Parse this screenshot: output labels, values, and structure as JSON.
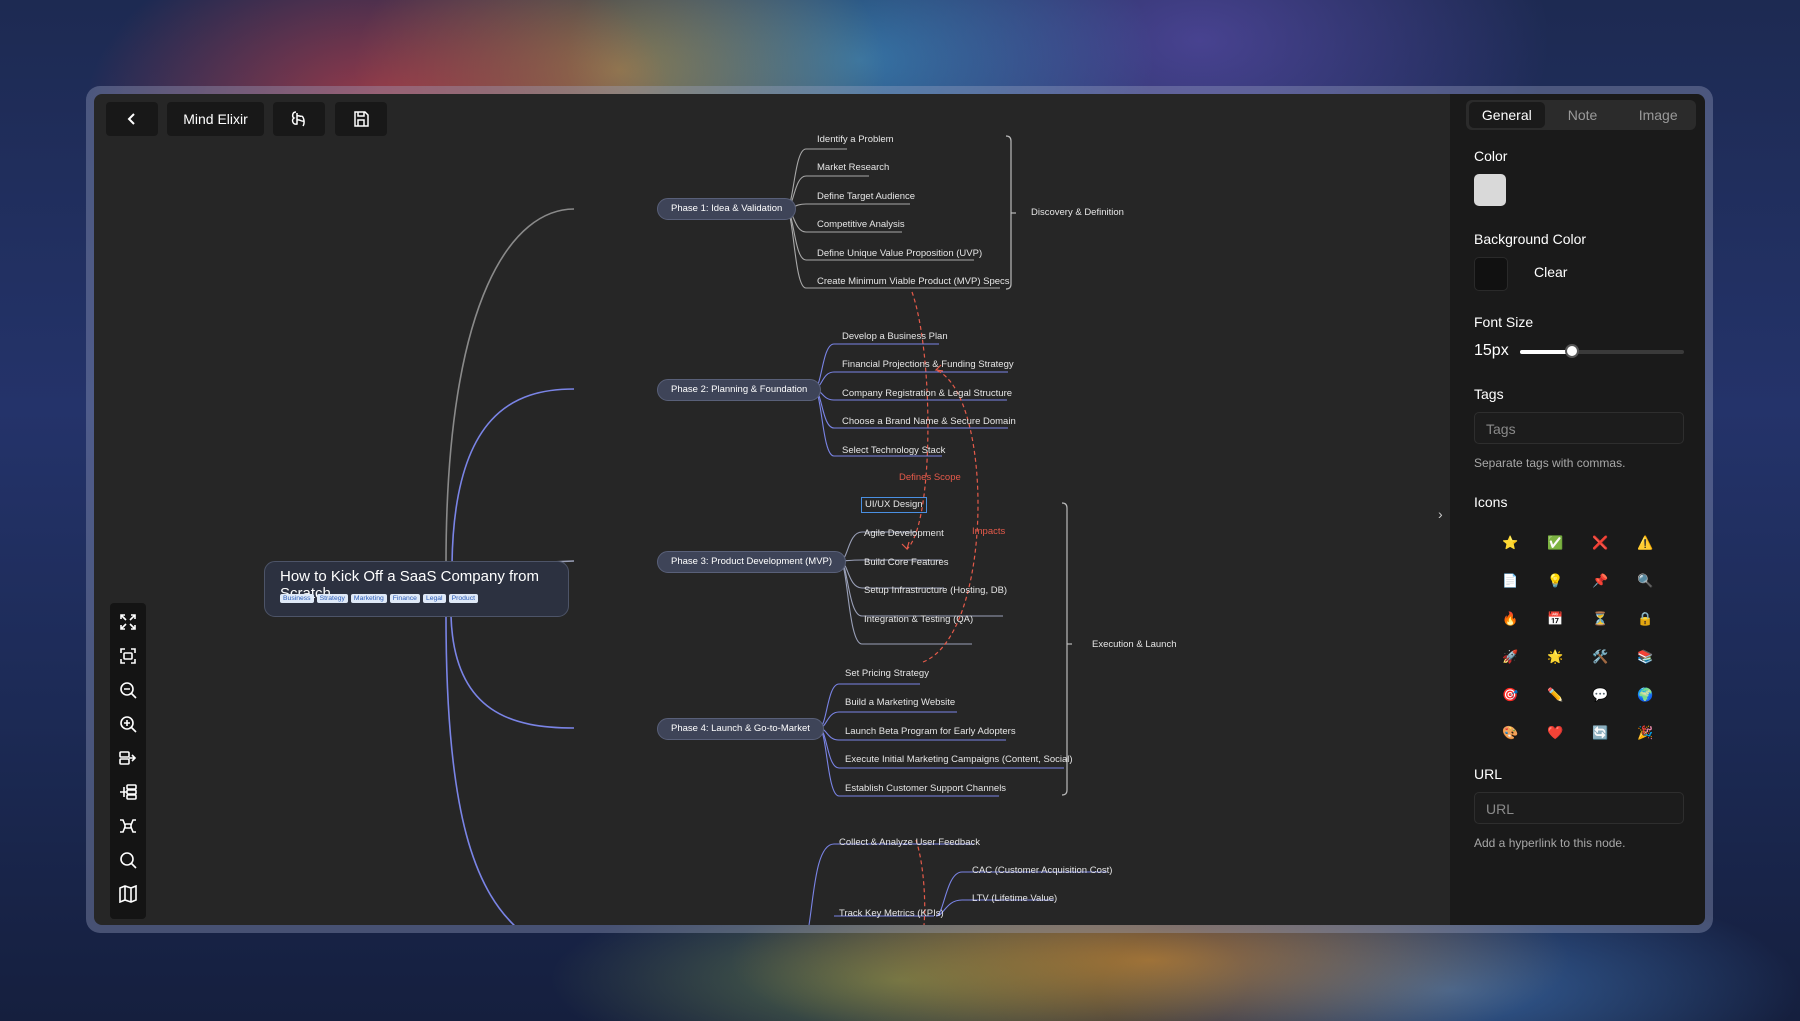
{
  "toolbar": {
    "app_name": "Mind Elixir"
  },
  "root": {
    "title": "How to Kick Off a SaaS Company from Scratch",
    "tags": [
      "Business",
      "Strategy",
      "Marketing",
      "Finance",
      "Legal",
      "Product"
    ]
  },
  "phases": [
    {
      "label": "Phase 1: Idea & Validation",
      "children": [
        "Identify a Problem",
        "Market Research",
        "Define Target Audience",
        "Competitive Analysis",
        "Define Unique Value Proposition (UVP)",
        "Create Minimum Viable Product (MVP) Specs"
      ]
    },
    {
      "label": "Phase 2: Planning & Foundation",
      "children": [
        "Develop a Business Plan",
        "Financial Projections & Funding Strategy",
        "Company Registration & Legal Structure",
        "Choose a Brand Name & Secure Domain",
        "Select Technology Stack"
      ]
    },
    {
      "label": "Phase 3: Product Development (MVP)",
      "children": [
        "UI/UX Design",
        "Agile Development",
        "Build Core Features",
        "Setup Infrastructure (Hosting, DB)",
        "Integration & Testing (QA)"
      ]
    },
    {
      "label": "Phase 4: Launch & Go-to-Market",
      "children": [
        "Set Pricing Strategy",
        "Build a Marketing Website",
        "Launch Beta Program for Early Adopters",
        "Execute Initial Marketing Campaigns (Content, Social)",
        "Establish Customer Support Channels"
      ]
    },
    {
      "label": "",
      "children": [
        "Collect & Analyze User Feedback",
        "Track Key Metrics (KPIs)",
        "CAC (Customer Acquisition Cost)",
        "LTV (Lifetime Value)"
      ]
    }
  ],
  "summaries": [
    "Discovery & Definition",
    "Execution & Launch"
  ],
  "arrow_labels": [
    "Defines Scope",
    "Impacts"
  ],
  "panel": {
    "tabs": [
      "General",
      "Note",
      "Image"
    ],
    "color_label": "Color",
    "color_value": "#d9d9d9",
    "bg_label": "Background Color",
    "bg_value": "#111111",
    "clear_label": "Clear",
    "font_size_label": "Font Size",
    "font_size_value": "15px",
    "font_size_fraction": 0.32,
    "tags_label": "Tags",
    "tags_placeholder": "Tags",
    "tags_hint": "Separate tags with commas.",
    "icons_label": "Icons",
    "icons": [
      "⭐",
      "✅",
      "❌",
      "⚠️",
      "📄",
      "💡",
      "📌",
      "🔍",
      "🔥",
      "📅",
      "⏳",
      "🔒",
      "🚀",
      "🌟",
      "🛠️",
      "📚",
      "🎯",
      "✏️",
      "💬",
      "🌍",
      "🎨",
      "❤️",
      "🔄",
      "🎉"
    ],
    "url_label": "URL",
    "url_placeholder": "URL",
    "url_hint": "Add a hyperlink to this node."
  }
}
